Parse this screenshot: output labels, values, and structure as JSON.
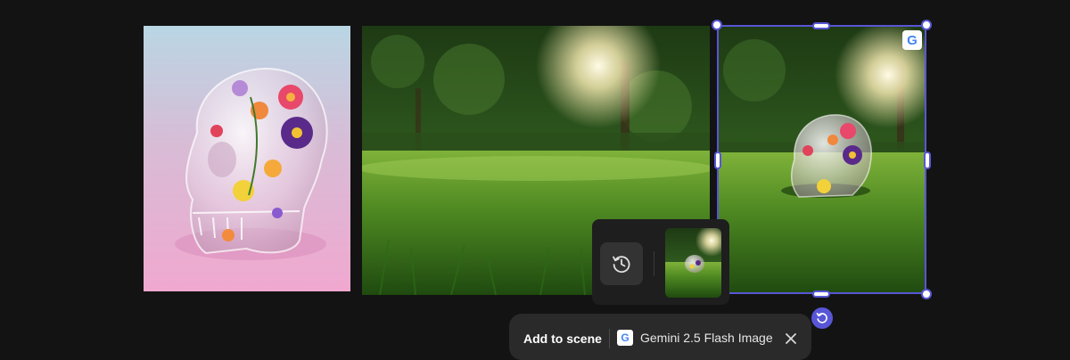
{
  "canvas": {
    "images": [
      {
        "name": "glass-skull-flowers"
      },
      {
        "name": "sunlit-grass-park"
      },
      {
        "name": "skull-on-grass-generated"
      }
    ],
    "provider_badge": "G"
  },
  "history": {
    "icon": "history-icon"
  },
  "toolbar": {
    "add_to_scene_label": "Add to scene",
    "model_label": "Gemini 2.5 Flash Image",
    "model_badge": "G",
    "close_icon": "close-icon"
  },
  "colors": {
    "accent": "#5856d6",
    "background": "#131313",
    "panel": "#2a2a2a"
  }
}
